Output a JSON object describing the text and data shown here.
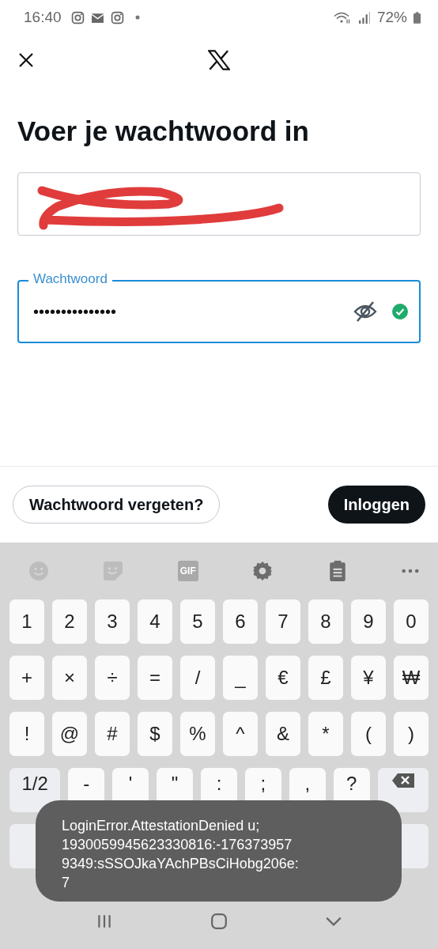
{
  "status_bar": {
    "time": "16:40",
    "battery": "72%"
  },
  "title": "Voer je wachtwoord in",
  "password_field": {
    "label": "Wachtwoord",
    "value": "•••••••••••••••",
    "focused": true,
    "visible": false,
    "valid": true
  },
  "buttons": [
    {
      "kind": "outline",
      "label": "Wachtwoord vergeten?"
    },
    {
      "kind": "primary",
      "label": "Inloggen"
    }
  ],
  "keyboard": {
    "toolbar": [
      {
        "kind": "emoji",
        "disabled": true
      },
      {
        "kind": "sticker",
        "disabled": true
      },
      {
        "kind": "gif",
        "label": "GIF",
        "disabled": true
      },
      {
        "kind": "settings",
        "disabled": false
      },
      {
        "kind": "clipboard",
        "disabled": false
      },
      {
        "kind": "more",
        "disabled": false
      }
    ],
    "key_rows": [
      {
        "keys": [
          {
            "label": "1"
          },
          {
            "label": "2"
          },
          {
            "label": "3"
          },
          {
            "label": "4"
          },
          {
            "label": "5"
          },
          {
            "label": "6"
          },
          {
            "label": "7"
          },
          {
            "label": "8"
          },
          {
            "label": "9"
          },
          {
            "label": "0"
          }
        ]
      },
      {
        "keys": [
          {
            "label": "+"
          },
          {
            "label": "×"
          },
          {
            "label": "÷"
          },
          {
            "label": "="
          },
          {
            "label": "/"
          },
          {
            "label": "_"
          },
          {
            "label": "€"
          },
          {
            "label": "£"
          },
          {
            "label": "¥"
          },
          {
            "label": "₩"
          }
        ]
      },
      {
        "keys": [
          {
            "label": "!"
          },
          {
            "label": "@"
          },
          {
            "label": "#"
          },
          {
            "label": "$"
          },
          {
            "label": "%"
          },
          {
            "label": "^"
          },
          {
            "label": "&"
          },
          {
            "label": "*"
          },
          {
            "label": "("
          },
          {
            "label": ")"
          }
        ]
      },
      {
        "keys": [
          {
            "label": "1/2",
            "kind": "mode"
          },
          {
            "label": "-"
          },
          {
            "label": "'"
          },
          {
            "label": "\""
          },
          {
            "label": ":"
          },
          {
            "label": ";"
          },
          {
            "label": ","
          },
          {
            "label": "?"
          },
          {
            "kind": "backspace"
          }
        ]
      },
      {
        "keys": [
          {
            "kind": "mode"
          },
          {
            "kind": "action"
          }
        ]
      }
    ]
  },
  "toast": {
    "lines": [
      "LoginError.AttestationDenied u;",
      "1930059945623330816:-176373957",
      "9349:sSSOJkaYAchPBsCiHobg206e:",
      "7"
    ]
  }
}
